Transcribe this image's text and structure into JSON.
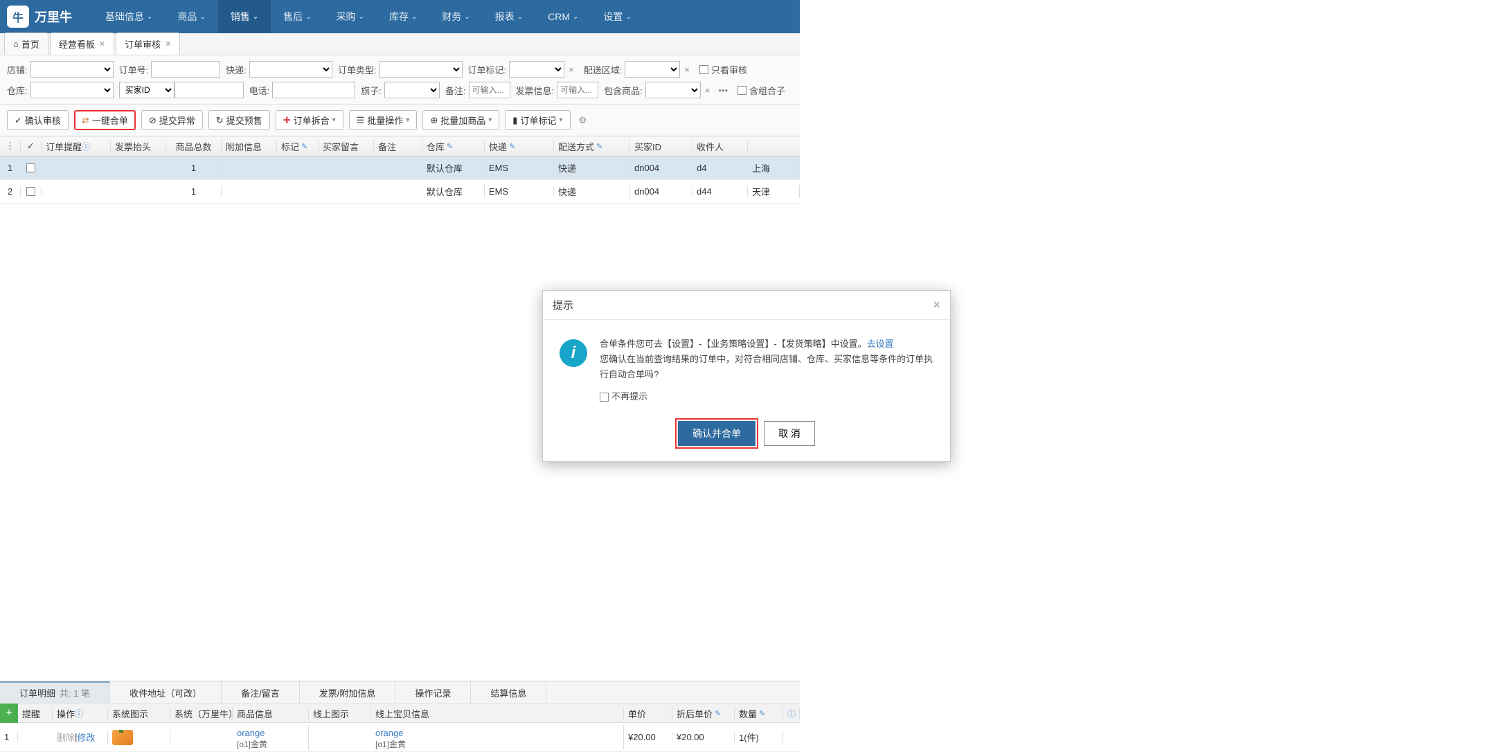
{
  "logo": {
    "text": "万里牛",
    "icon": "牛"
  },
  "nav": [
    {
      "label": "基础信息",
      "active": false
    },
    {
      "label": "商品",
      "active": false
    },
    {
      "label": "销售",
      "active": true
    },
    {
      "label": "售后",
      "active": false
    },
    {
      "label": "采购",
      "active": false
    },
    {
      "label": "库存",
      "active": false
    },
    {
      "label": "财务",
      "active": false
    },
    {
      "label": "报表",
      "active": false
    },
    {
      "label": "CRM",
      "active": false
    },
    {
      "label": "设置",
      "active": false
    }
  ],
  "tabs": [
    {
      "label": "首页",
      "home": true
    },
    {
      "label": "经营看板",
      "closable": true
    },
    {
      "label": "订单审核",
      "closable": true,
      "active": true
    }
  ],
  "filters": {
    "shop": "店铺:",
    "order_no": "订单号:",
    "express": "快递:",
    "order_type": "订单类型:",
    "order_mark": "订单标记:",
    "delivery_area": "配送区域:",
    "audit_only": "只看审核",
    "warehouse": "仓库:",
    "buyer_id": "买家ID",
    "phone": "电话:",
    "flag": "旗子:",
    "note": "备注:",
    "note_placeholder": "可输入...",
    "invoice_info": "发票信息:",
    "invoice_placeholder": "可输入...",
    "include_goods": "包含商品:",
    "include_combo": "含组合子"
  },
  "toolbar": {
    "confirm_audit": "确认审核",
    "merge_order": "一键合单",
    "submit_exception": "提交异常",
    "submit_presale": "提交预售",
    "split_order": "订单拆合",
    "batch_op": "批量操作",
    "batch_add_goods": "批量加商品",
    "order_mark": "订单标记"
  },
  "grid_headers": {
    "remind": "订单提醒",
    "invoice_head": "发票抬头",
    "goods_total": "商品总数",
    "addl_info": "附加信息",
    "mark": "标记",
    "buyer_msg": "买家留言",
    "note": "备注",
    "warehouse": "仓库",
    "express": "快递",
    "delivery": "配送方式",
    "buyer_id": "买家ID",
    "recipient": "收件人"
  },
  "grid_rows": [
    {
      "num": "1",
      "qty": "1",
      "warehouse": "默认仓库",
      "express": "EMS",
      "delivery": "快递",
      "buyer_id": "dn004",
      "recipient": "d4",
      "addr": "上海",
      "selected": true
    },
    {
      "num": "2",
      "qty": "1",
      "warehouse": "默认仓库",
      "express": "EMS",
      "delivery": "快递",
      "buyer_id": "dn004",
      "recipient": "d44",
      "addr": "天津"
    }
  ],
  "modal": {
    "title": "提示",
    "text1": "合单条件您可去【设置】-【业务策略设置】-【发货策略】中设置。",
    "link": "去设置",
    "text2": "您确认在当前查询结果的订单中，对符合相同店铺、仓库、买家信息等条件的订单执行自动合单吗?",
    "no_remind": "不再提示",
    "confirm": "确认并合单",
    "cancel": "取 消"
  },
  "bottom_tabs": [
    {
      "label": "订单明细",
      "count": "共: 1 笔",
      "active": true
    },
    {
      "label": "收件地址（可改）"
    },
    {
      "label": "备注/留言"
    },
    {
      "label": "发票/附加信息"
    },
    {
      "label": "操作记录"
    },
    {
      "label": "结算信息"
    }
  ],
  "detail_headers": {
    "remind": "提醒",
    "op": "操作",
    "sysimg": "系统图示",
    "sys": "系统（万里牛）",
    "goods": "商品信息",
    "onlineimg": "线上图示",
    "baby": "线上宝贝信息",
    "price": "单价",
    "discount": "折后单价",
    "qty": "数量"
  },
  "detail_rows": [
    {
      "num": "1",
      "op_del": "删除",
      "op_edit": "修改",
      "goods_name": "orange",
      "goods_sub": "[o1]金黄",
      "baby_name": "orange",
      "baby_sub": "[o1]金黄",
      "price": "¥20.00",
      "discount": "¥20.00",
      "qty": "1(件)"
    }
  ]
}
